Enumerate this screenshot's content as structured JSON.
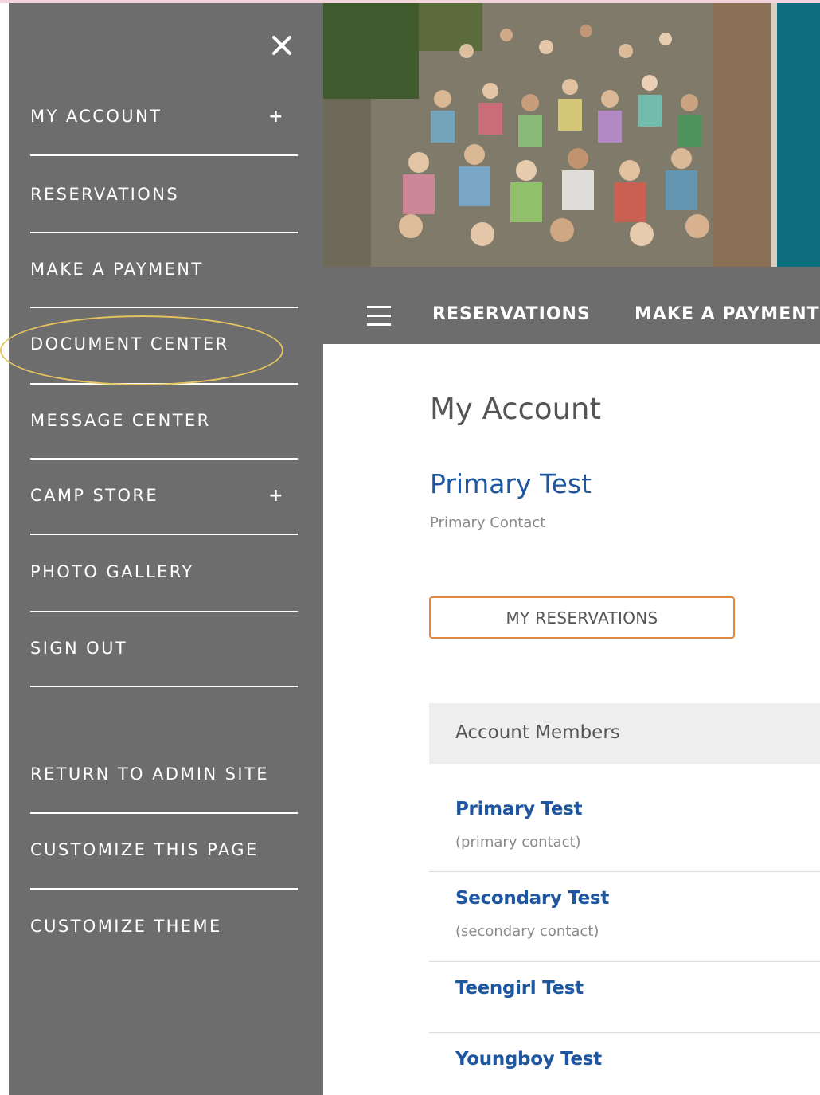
{
  "sidebar": {
    "close_icon": "close-icon",
    "items": [
      {
        "label": "MY ACCOUNT",
        "expandable": true,
        "expand_symbol": "+"
      },
      {
        "label": "RESERVATIONS"
      },
      {
        "label": "MAKE A PAYMENT"
      },
      {
        "label": "DOCUMENT CENTER",
        "highlighted": true
      },
      {
        "label": "MESSAGE CENTER"
      },
      {
        "label": "CAMP STORE",
        "expandable": true,
        "expand_symbol": "+"
      },
      {
        "label": "PHOTO GALLERY"
      },
      {
        "label": "SIGN OUT"
      }
    ],
    "admin_items": [
      {
        "label": "RETURN TO ADMIN SITE"
      },
      {
        "label": "CUSTOMIZE THIS PAGE"
      },
      {
        "label": "CUSTOMIZE THEME"
      }
    ]
  },
  "topnav": {
    "menu_icon": "hamburger-menu-icon",
    "links": [
      "RESERVATIONS",
      "MAKE A PAYMENT"
    ]
  },
  "main": {
    "title": "My Account",
    "account_name": "Primary Test",
    "account_role": "Primary Contact",
    "my_reservations_button": "MY RESERVATIONS",
    "members_header": "Account Members",
    "members": [
      {
        "name": "Primary Test",
        "role": "(primary contact)"
      },
      {
        "name": "Secondary Test",
        "role": "(secondary contact)"
      },
      {
        "name": "Teengirl Test",
        "role": ""
      },
      {
        "name": "Youngboy Test",
        "role": ""
      }
    ]
  },
  "colors": {
    "sidebar_bg": "#6d6d6d",
    "link_blue": "#1e56a0",
    "button_border": "#e0893f",
    "highlight": "#e6c35f",
    "hero_accent": "#0f6e7e"
  }
}
